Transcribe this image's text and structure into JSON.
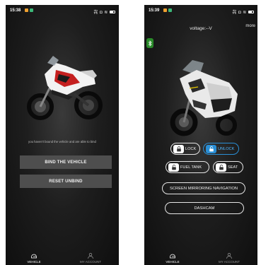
{
  "left_screen": {
    "status_time": "15:38",
    "status_icons": "㐂 ◘ ≋",
    "hint_text": "you haven't bound the vehicle and are able to bind",
    "bind_button": "BIND THE VEHICLE",
    "reset_button": "RESET UNBIND",
    "tabs": [
      {
        "label": "VEHICLE",
        "icon": "helmet-icon"
      },
      {
        "label": "MY ACCOUNT",
        "icon": "person-icon"
      }
    ]
  },
  "right_screen": {
    "status_time": "15:39",
    "status_icons": "㐂 ◘ ≋",
    "voltage": "voltage:--V",
    "more": "more",
    "controls": {
      "lock": "LOCK",
      "unlock": "UNLOCK",
      "fuel_tank": "FUEL TANK",
      "seat": "SEAT",
      "mirroring": "SCREEN MIRRORING NAVIGATION",
      "dashcam": "DASHCAM"
    },
    "tabs": [
      {
        "label": "VEHICLE",
        "icon": "helmet-icon"
      },
      {
        "label": "MY ACCOUNT",
        "icon": "person-icon"
      }
    ]
  },
  "colors": {
    "accent_blue": "#2a8fd6",
    "button_gray": "#4e4e4e",
    "bluetooth_green": "#2a8a2a",
    "bike_red": "#c41f1f"
  }
}
